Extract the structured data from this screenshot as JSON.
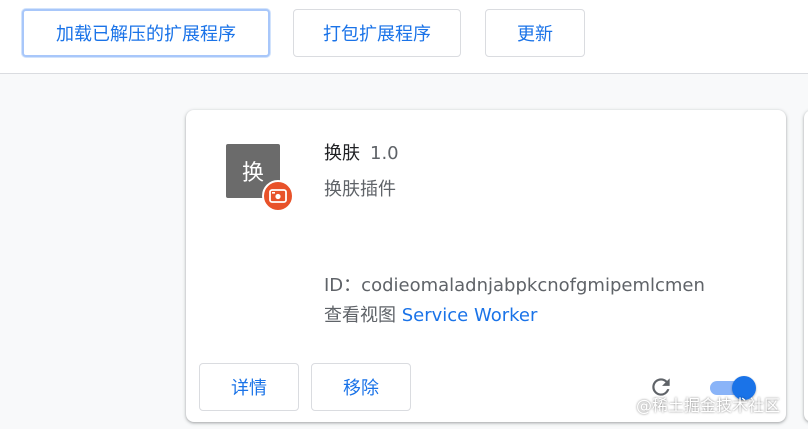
{
  "toolbar": {
    "load_unpacked_label": "加载已解压的扩展程序",
    "pack_label": "打包扩展程序",
    "update_label": "更新"
  },
  "extension": {
    "icon_text": "换",
    "name": "换肤",
    "version": "1.0",
    "description": "换肤插件",
    "id_line": "ID：codieomaladnjabpkcnofgmipemlcmen",
    "inspect_views_label": "查看视图",
    "inspect_views_link": "Service Worker",
    "details_label": "详情",
    "remove_label": "移除",
    "enabled": true,
    "icons": {
      "badge": "unpacked-badge-icon",
      "reload": "reload-icon"
    }
  },
  "watermark": "@稀土掘金技术社区",
  "colors": {
    "accent": "#1a73e8",
    "badge": "#e8522a",
    "icon_bg": "#6b6b6b"
  }
}
